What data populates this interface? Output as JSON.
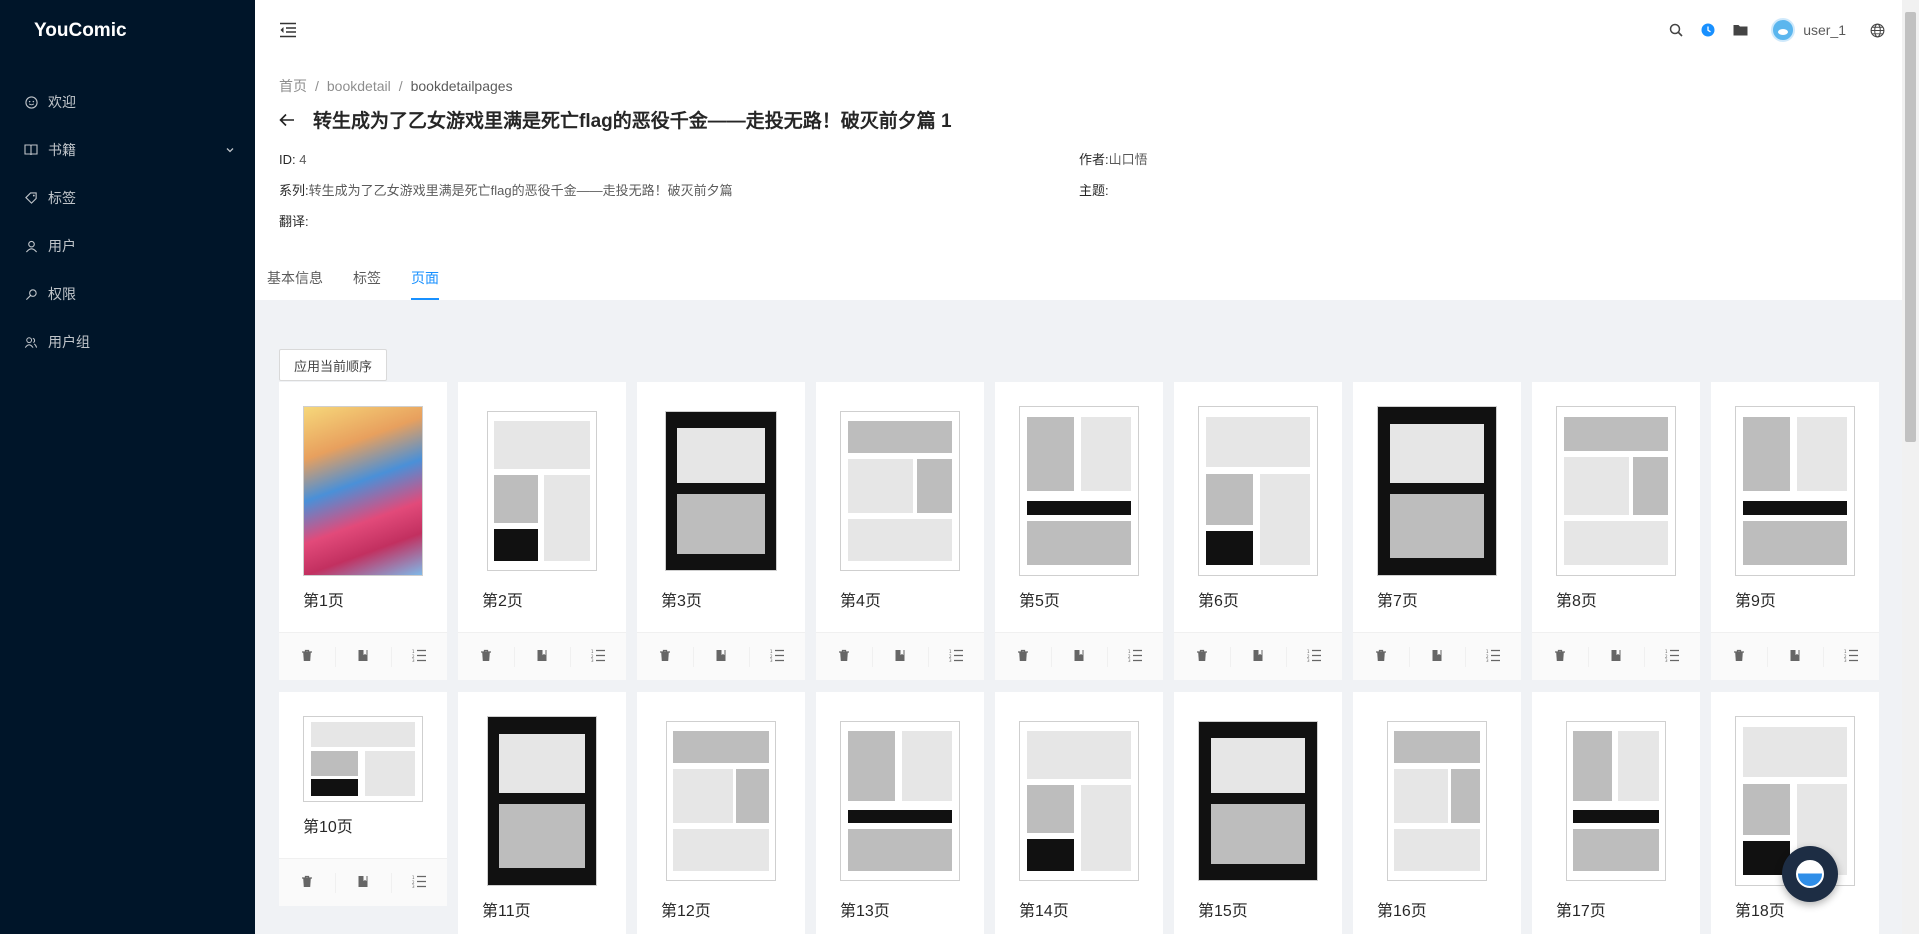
{
  "app": {
    "name": "YouComic"
  },
  "sidebar": {
    "items": [
      {
        "label": "欢迎",
        "icon": "smile-icon"
      },
      {
        "label": "书籍",
        "icon": "book-icon",
        "expandable": true
      },
      {
        "label": "标签",
        "icon": "tag-icon"
      },
      {
        "label": "用户",
        "icon": "user-icon"
      },
      {
        "label": "权限",
        "icon": "key-icon"
      },
      {
        "label": "用户组",
        "icon": "team-icon"
      }
    ]
  },
  "header": {
    "username": "user_1"
  },
  "breadcrumb": {
    "home": "首页",
    "level2": "bookdetail",
    "current": "bookdetailpages"
  },
  "book": {
    "title": "转生成为了乙女游戏里满是死亡flag的恶役千金——走投无路！破灭前夕篇 1",
    "id_label": "ID:",
    "id_value": "4",
    "author_label": "作者:",
    "author_value": "山口悟",
    "series_label": "系列:",
    "series_value": "转生成为了乙女游戏里满是死亡flag的恶役千金——走投无路！破灭前夕篇",
    "theme_label": "主题:",
    "translator_label": "翻译:"
  },
  "tabs": [
    {
      "label": "基本信息",
      "active": false
    },
    {
      "label": "标签",
      "active": false
    },
    {
      "label": "页面",
      "active": true
    }
  ],
  "toolbar": {
    "apply_order_label": "应用当前顺序"
  },
  "pages": [
    "第1页",
    "第2页",
    "第3页",
    "第4页",
    "第5页",
    "第6页",
    "第7页",
    "第8页",
    "第9页",
    "第10页",
    "第11页",
    "第12页",
    "第13页",
    "第14页",
    "第15页",
    "第16页",
    "第17页",
    "第18页"
  ],
  "colors": {
    "sider": "#001529",
    "primary": "#1890ff",
    "bg": "#f0f2f5"
  }
}
